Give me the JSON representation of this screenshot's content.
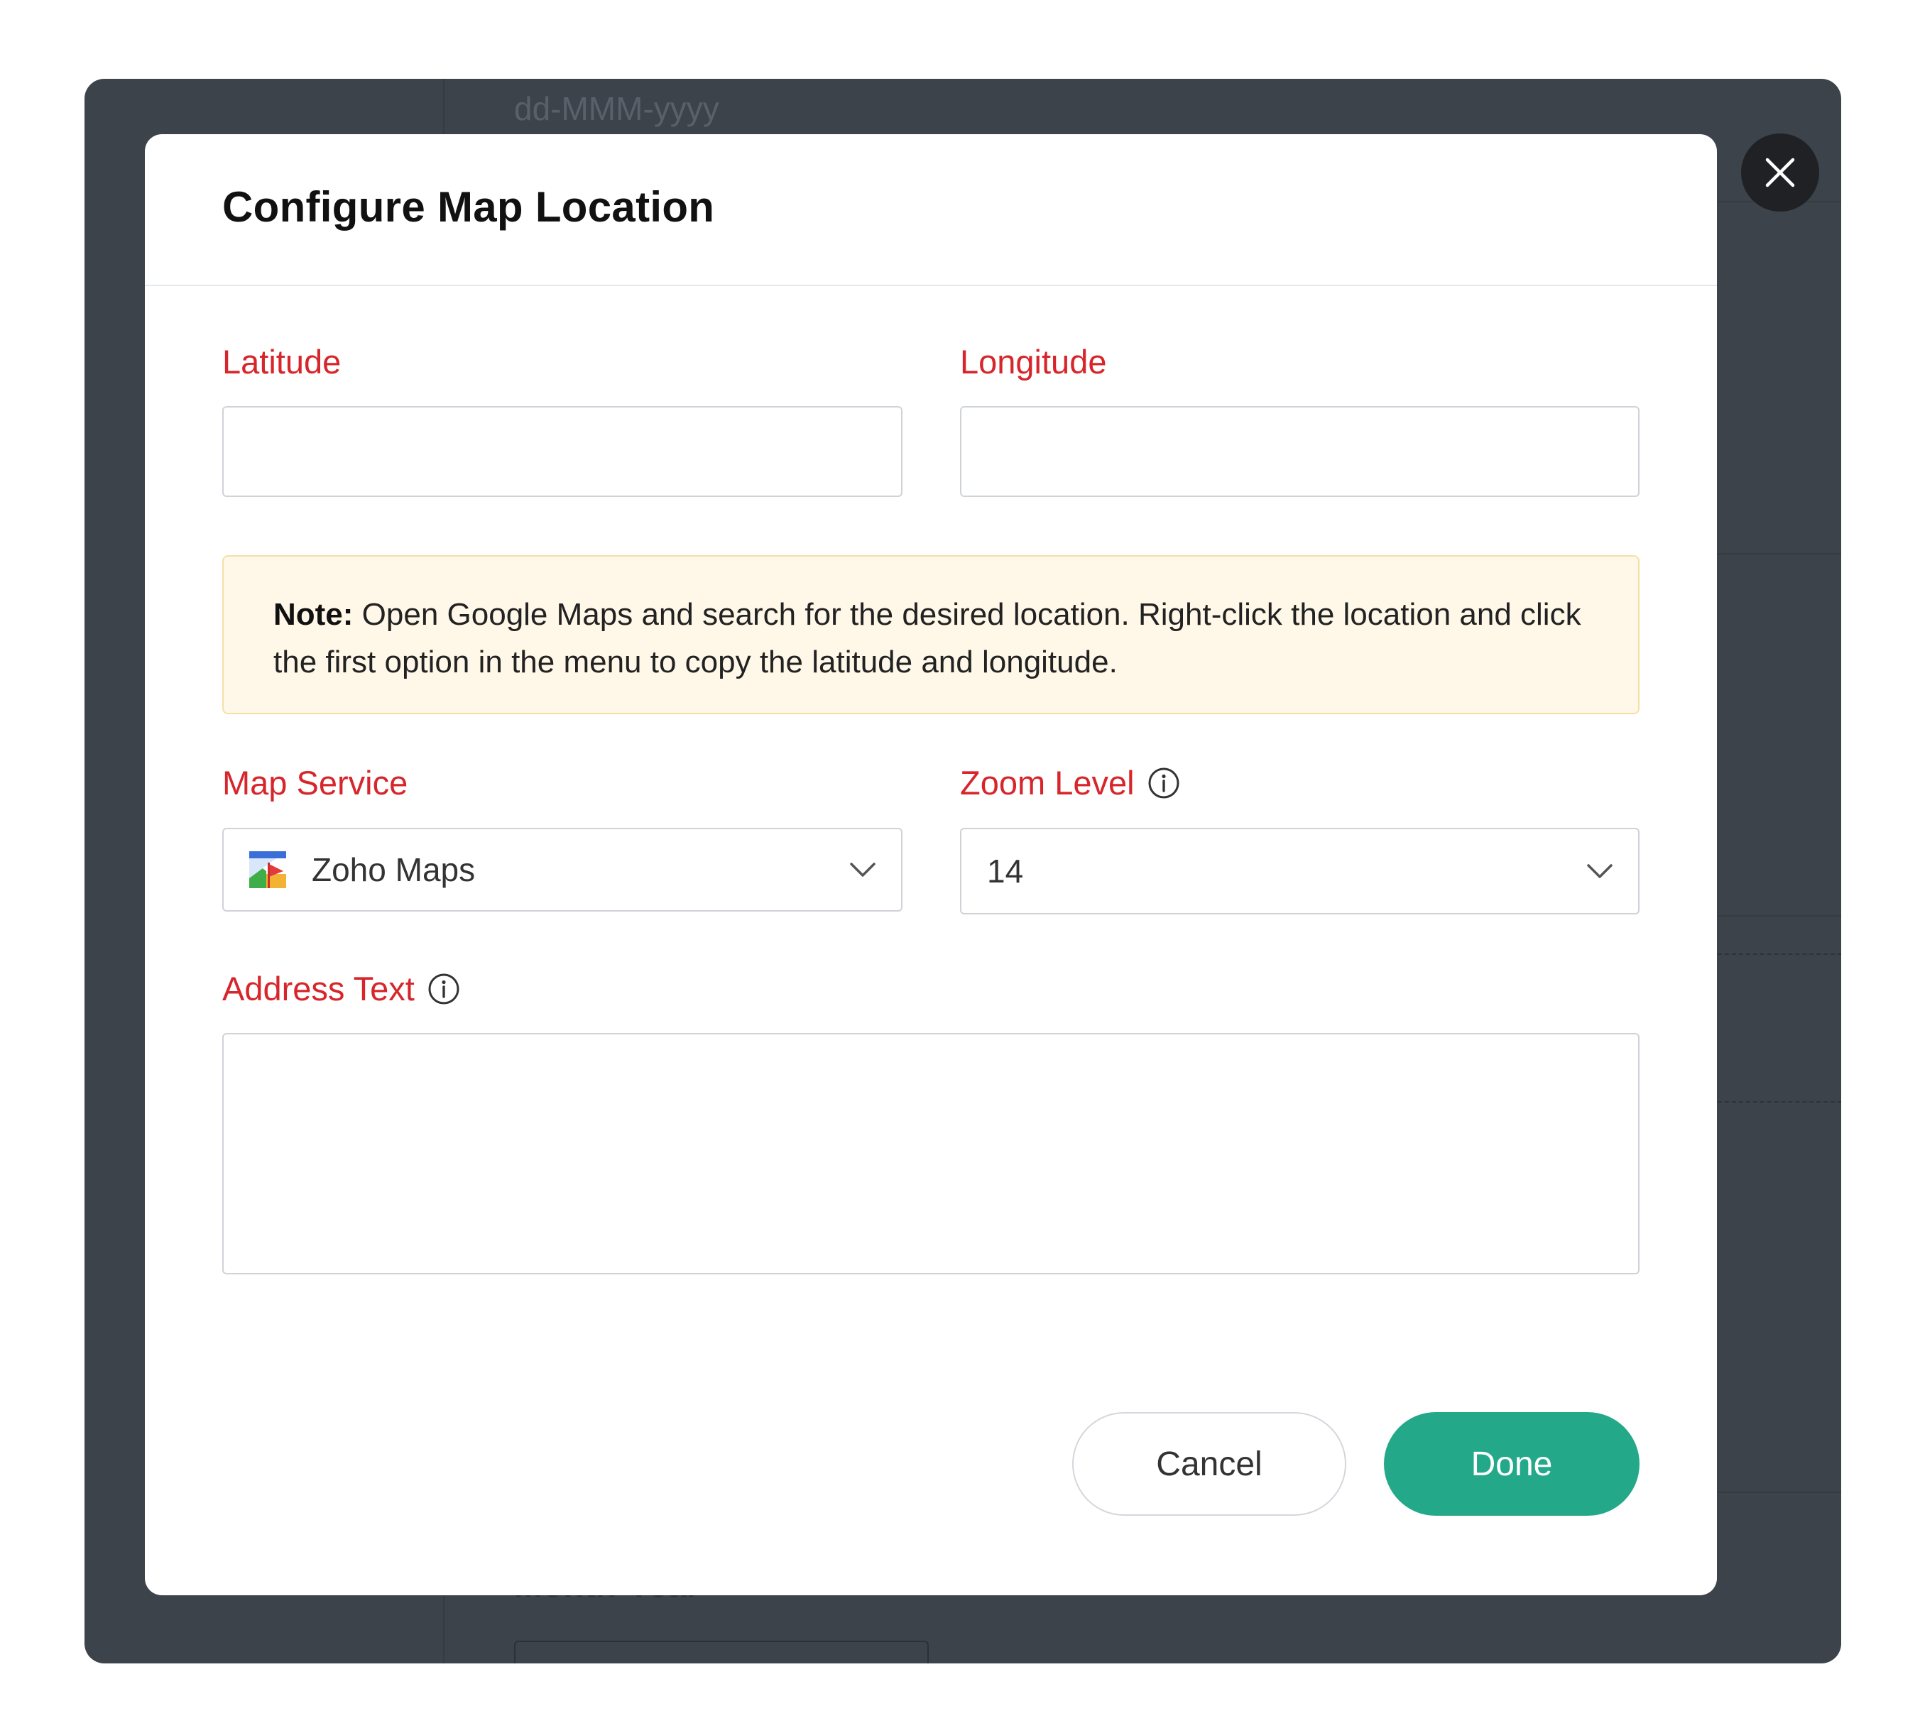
{
  "background": {
    "date_format_text": "dd-MMM-yyyy",
    "month_year_label": "Month-Year"
  },
  "modal": {
    "title": "Configure Map Location",
    "latitude": {
      "label": "Latitude",
      "value": ""
    },
    "longitude": {
      "label": "Longitude",
      "value": ""
    },
    "note": {
      "prefix": "Note:",
      "text": " Open Google Maps and search for the desired location. Right-click the location and click the first option in the menu to copy the latitude and longitude."
    },
    "map_service": {
      "label": "Map Service",
      "selected": "Zoho Maps",
      "icon": "zoho-maps-icon"
    },
    "zoom_level": {
      "label": "Zoom Level",
      "selected": "14",
      "icon": "info-icon"
    },
    "address_text": {
      "label": "Address Text",
      "value": "",
      "icon": "info-icon"
    },
    "buttons": {
      "cancel": "Cancel",
      "done": "Done"
    }
  },
  "colors": {
    "required_label": "#d7262b",
    "primary_button": "#23a98a",
    "note_background": "#fff8e8",
    "overlay": "#3d434a"
  }
}
